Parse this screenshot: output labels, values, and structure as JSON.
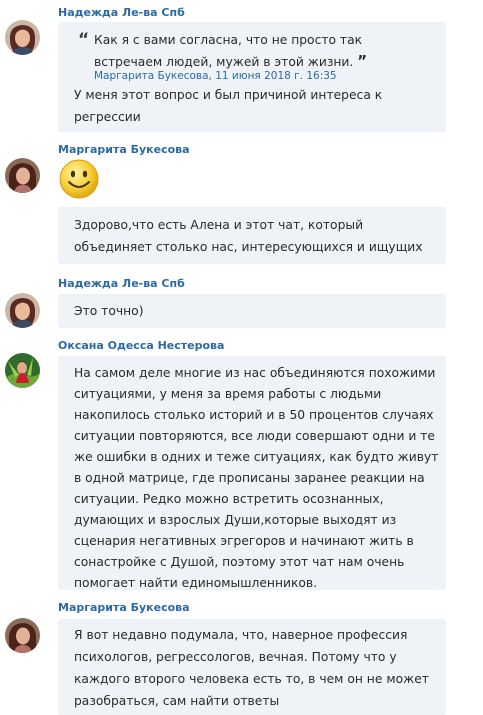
{
  "messages": [
    {
      "author": "Надежда Ле-ва Спб",
      "quote": {
        "text": "Как я с вами согласна, что не просто так встречаем людей, мужей в этой жизни.",
        "meta": "Маргарита Букесова, 11 июня 2018 г. 16:35"
      },
      "text": "У меня этот вопрос и был причиной интереса к регрессии"
    },
    {
      "author": "Маргарита Букесова",
      "emoji": "smiley-emoji",
      "text": "Здорово,что есть Алена и этот чат, который объединяет столько нас, интересующихся и ищущих"
    },
    {
      "author": "Надежда Ле-ва Спб",
      "text": "Это точно)"
    },
    {
      "author": "Оксана Одесса Нестерова",
      "text": "На самом деле многие из нас объединяются похожими ситуациями, у меня за время работы с людьми накопилось столько историй и в 50 процентов случаях ситуации повторяются, все люди совершают одни и те же ошибки в одних и теже ситуациях, как будто живут в одной матрице, где прописаны заранее реакции на ситуации. Редко можно встретить осознанных, думающих и взрослых Души,которые выходят из сценария негативных эгрегоров и начинают жить в сонастройке с Душой, поэтому этот чат нам очень помогает найти единомышленников."
    },
    {
      "author": "Маргарита Букесова",
      "text": "Я вот недавно подумала, что, наверное профессия психологов, регрессологов, вечная. Потому что у каждого второго человека есть то, в чем он не может разобраться, сам найти ответы"
    }
  ],
  "quote_open_mark": "“",
  "quote_close_mark": "”",
  "colors": {
    "author_name": "#2b6aa7",
    "bubble_bg": "#eff2f6",
    "text": "#2a2a2a"
  },
  "icons": [
    "avatar-nadezhda",
    "avatar-margarita",
    "avatar-oksana",
    "smiley-emoji"
  ]
}
